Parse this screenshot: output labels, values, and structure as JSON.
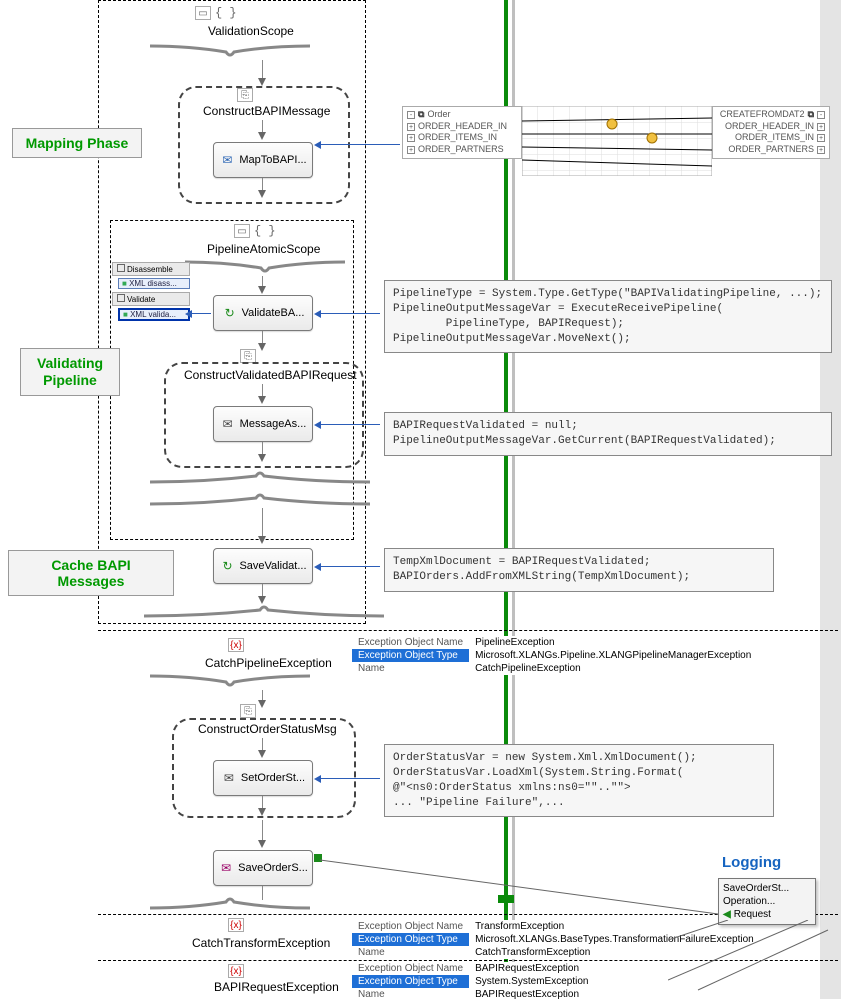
{
  "phases": {
    "mapping": "Mapping Phase",
    "validating": "Validating\nPipeline",
    "cache": "Cache BAPI Messages",
    "logging": "Logging"
  },
  "shapes": {
    "validationScope": "ValidationScope",
    "constructBapiMessage": "ConstructBAPIMessage",
    "mapToBapi": "MapToBAPI...",
    "pipelineAtomicScope": "PipelineAtomicScope",
    "validateBA": "ValidateBA...",
    "constructValidated": "ConstructValidatedBAPIRequest",
    "messageAs": "MessageAs...",
    "saveValidat": "SaveValidat...",
    "catchPipelineException": "CatchPipelineException",
    "constructOrderStatusMsg": "ConstructOrderStatusMsg",
    "setOrderSt": "SetOrderSt...",
    "saveOrderS": "SaveOrderS...",
    "catchTransformException": "CatchTransformException",
    "bapiRequestException": "BAPIRequestException"
  },
  "pipelineMini": {
    "stage1": "Disassemble",
    "item1": "XML disass...",
    "stage2": "Validate",
    "item2": "XML valida..."
  },
  "mapper": {
    "leftRoot": "Order",
    "left": [
      "ORDER_HEADER_IN",
      "ORDER_ITEMS_IN",
      "ORDER_PARTNERS"
    ],
    "rightRoot": "CREATEFROMDAT2",
    "right": [
      "ORDER_HEADER_IN",
      "ORDER_ITEMS_IN",
      "ORDER_PARTNERS"
    ]
  },
  "code": {
    "validate": "PipelineType = System.Type.GetType(\"BAPIValidatingPipeline, ...);\nPipelineOutputMessageVar = ExecuteReceivePipeline(\n        PipelineType, BAPIRequest);\nPipelineOutputMessageVar.MoveNext();",
    "messageAs": "BAPIRequestValidated = null;\nPipelineOutputMessageVar.GetCurrent(BAPIRequestValidated);",
    "saveValidat": "TempXmlDocument = BAPIRequestValidated;\nBAPIOrders.AddFromXMLString(TempXmlDocument);",
    "setOrderSt": "OrderStatusVar = new System.Xml.XmlDocument();\nOrderStatusVar.LoadXml(System.String.Format(\n@\"<ns0:OrderStatus xmlns:ns0=\"\"..\"\">\n... \"Pipeline Failure\",..."
  },
  "props": {
    "labels": {
      "exObjName": "Exception Object Name",
      "exObjType": "Exception Object Type",
      "name": "Name"
    },
    "pipeline": {
      "exObjName": "PipelineException",
      "exObjType": "Microsoft.XLANGs.Pipeline.XLANGPipelineManagerException",
      "name": "CatchPipelineException"
    },
    "transform": {
      "exObjName": "TransformException",
      "exObjType": "Microsoft.XLANGs.BaseTypes.TransformationFailureException",
      "name": "CatchTransformException"
    },
    "bapireq": {
      "exObjName": "BAPIRequestException",
      "exObjType": "System.SystemException",
      "name": "BAPIRequestException"
    }
  },
  "logWindow": {
    "line1": "SaveOrderSt...",
    "line2": "Operation...",
    "line3": "Request"
  }
}
